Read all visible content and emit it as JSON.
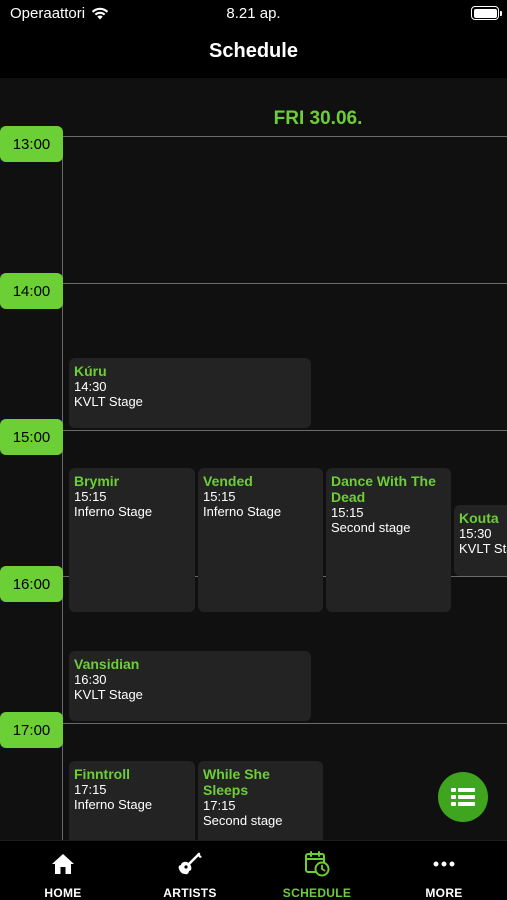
{
  "status": {
    "carrier": "Operaattori",
    "time": "8.21 ap."
  },
  "nav": {
    "title": "Schedule"
  },
  "schedule": {
    "day": "FRI 30.06.",
    "times": [
      "13:00",
      "14:00",
      "15:00",
      "16:00",
      "17:00"
    ],
    "events": [
      {
        "name": "Kúru",
        "time": "14:30",
        "stage": "KVLT Stage"
      },
      {
        "name": "Brymir",
        "time": "15:15",
        "stage": "Inferno Stage"
      },
      {
        "name": "Vended",
        "time": "15:15",
        "stage": "Inferno Stage"
      },
      {
        "name": "Dance With The Dead",
        "time": "15:15",
        "stage": "Second stage"
      },
      {
        "name": "Kouta",
        "time": "15:30",
        "stage": "KVLT Stage"
      },
      {
        "name": "Vansidian",
        "time": "16:30",
        "stage": "KVLT Stage"
      },
      {
        "name": "Finntroll",
        "time": "17:15",
        "stage": "Inferno Stage"
      },
      {
        "name": "While She Sleeps",
        "time": "17:15",
        "stage": "Second stage"
      }
    ]
  },
  "tabbar": {
    "tabs": [
      {
        "label": "HOME",
        "icon": "home-icon"
      },
      {
        "label": "ARTISTS",
        "icon": "guitar-icon"
      },
      {
        "label": "SCHEDULE",
        "icon": "calendar-clock-icon"
      },
      {
        "label": "MORE",
        "icon": "more-dots-icon"
      }
    ],
    "active": "SCHEDULE"
  },
  "colors": {
    "accent": "#6ccf35",
    "fab": "#3fa51e",
    "card": "#232323",
    "background": "#101010"
  }
}
